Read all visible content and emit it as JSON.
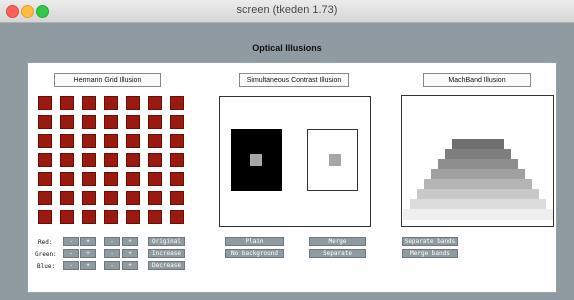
{
  "window": {
    "title": "screen (tkeden 1.73)"
  },
  "app": {
    "title": "Optical Illusions"
  },
  "sections": {
    "hermann": {
      "label": "Hermann Grid Illusion"
    },
    "contrast": {
      "label": "Simultaneous Contrast Illusion"
    },
    "machband": {
      "label": "MachBand Illusion"
    }
  },
  "controls": {
    "red_label": "Red:",
    "green_label": "Green:",
    "blue_label": "Blue:",
    "minus": "-",
    "plus": "+",
    "original": "Original",
    "increase": "Increase",
    "decrease": "Decrease",
    "plain_background": "Plain background",
    "no_background": "No background",
    "merge": "Merge",
    "separate": "Separate",
    "separate_bands": "Separate bands",
    "merge_bands": "Merge bands"
  },
  "colors": {
    "grid_square": "#9a1a10",
    "window_bg": "#8f9aa1",
    "button_bg": "#8f9aa1"
  },
  "illusions": {
    "hermann_grid": {
      "rows": 7,
      "cols": 7
    },
    "machband": {
      "band_grays": [
        "#6f6f6f",
        "#7e7e7e",
        "#8e8e8e",
        "#a0a0a0",
        "#b4b4b4",
        "#c8c8c8",
        "#dcdcdc",
        "#efefef"
      ]
    }
  }
}
